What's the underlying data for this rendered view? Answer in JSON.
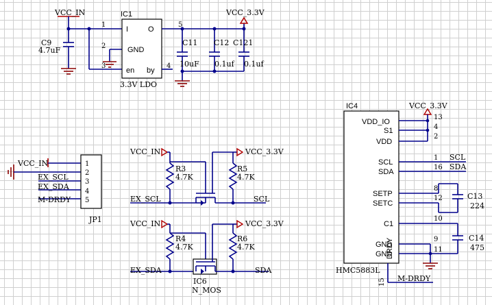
{
  "ldo": {
    "designator": "IC1",
    "value": "3.3V LDO",
    "pin_I": "I",
    "pin_O": "O",
    "pin_GND": "GND",
    "pin_en": "en",
    "pin_by": "by",
    "pin_1": "1",
    "pin_2": "2",
    "pin_3": "3",
    "pin_5": "5",
    "pin_4": "4"
  },
  "power": {
    "vcc_in": "VCC_IN",
    "vcc_3v3": "VCC_3.3V"
  },
  "caps": {
    "c9_name": "C9",
    "c9_val": "4.7uF",
    "c11_name": "C11",
    "c11_val": "10uF",
    "c12_name": "C12",
    "c12_val": "0.1uf",
    "c121_name": "C121",
    "c121_val": "0.1uf",
    "c13_name": "C13",
    "c13_val": "224",
    "c14_name": "C14",
    "c14_val": "475"
  },
  "connector": {
    "designator": "JP1",
    "pins": [
      "1",
      "2",
      "3",
      "4",
      "5"
    ],
    "nets": [
      "VCC_IN",
      "EX_SCL",
      "EX_SDA",
      "M-DRDY"
    ]
  },
  "level_shifter": {
    "r3": "R3",
    "r4": "R4",
    "r5": "R5",
    "r6": "R6",
    "r_val": "4.7K",
    "ex_scl": "EX_SCL",
    "scl": "SCL",
    "ex_sda": "EX_SDA",
    "sda": "SDA",
    "mos_name": "IC6",
    "mos_type": "N_MOS"
  },
  "sensor": {
    "designator": "IC4",
    "part": "HMC5883L",
    "pins_left": [
      "VDD_IO",
      "S1",
      "VDD",
      "SCL",
      "SDA",
      "SETP",
      "SETC",
      "C1",
      "GND",
      "GND"
    ],
    "pin_drdy": "DRDY",
    "pin_numbers": [
      "13",
      "4",
      "2",
      "1",
      "16",
      "8",
      "12",
      "10",
      "9",
      "11",
      "15"
    ],
    "nets": {
      "scl": "SCL",
      "sda": "SDA",
      "drdy": "M-DRDY"
    }
  }
}
